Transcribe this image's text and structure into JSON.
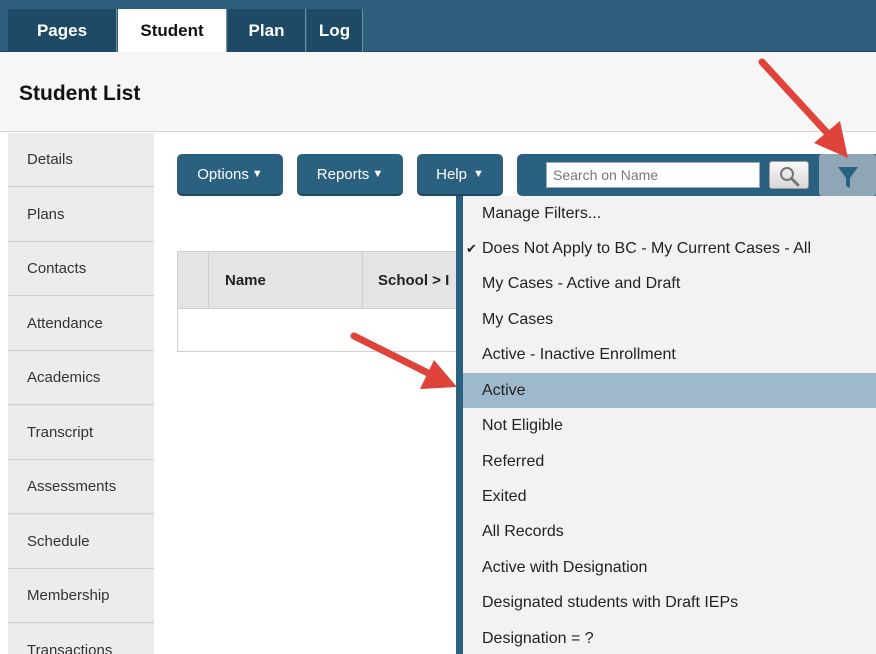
{
  "tabs": [
    {
      "label": "Pages",
      "active": false
    },
    {
      "label": "Student",
      "active": true
    },
    {
      "label": "Plan",
      "active": false
    },
    {
      "label": "Log",
      "active": false
    }
  ],
  "page_title": "Student List",
  "sidebar": {
    "items": [
      {
        "label": "Details"
      },
      {
        "label": "Plans"
      },
      {
        "label": "Contacts"
      },
      {
        "label": "Attendance"
      },
      {
        "label": "Academics"
      },
      {
        "label": "Transcript"
      },
      {
        "label": "Assessments"
      },
      {
        "label": "Schedule"
      },
      {
        "label": "Membership"
      },
      {
        "label": "Transactions"
      }
    ]
  },
  "toolbar": {
    "options_label": "Options",
    "reports_label": "Reports",
    "help_label": "Help",
    "caret": "▼"
  },
  "search": {
    "placeholder": "Search on Name",
    "search_icon": "magnifier-icon",
    "filter_icon": "funnel-icon"
  },
  "table": {
    "columns": [
      "Name",
      "School > I"
    ]
  },
  "filter_menu": {
    "items": [
      {
        "label": "Manage Filters...",
        "checked": false,
        "selected": false
      },
      {
        "label": "Does Not Apply to BC - My Current Cases - All",
        "checked": true,
        "selected": false
      },
      {
        "label": "My Cases - Active and Draft",
        "checked": false,
        "selected": false
      },
      {
        "label": "My Cases",
        "checked": false,
        "selected": false
      },
      {
        "label": "Active - Inactive Enrollment",
        "checked": false,
        "selected": false
      },
      {
        "label": "Active",
        "checked": false,
        "selected": true
      },
      {
        "label": "Not Eligible",
        "checked": false,
        "selected": false
      },
      {
        "label": "Referred",
        "checked": false,
        "selected": false
      },
      {
        "label": "Exited",
        "checked": false,
        "selected": false
      },
      {
        "label": "All Records",
        "checked": false,
        "selected": false
      },
      {
        "label": "Active with Designation",
        "checked": false,
        "selected": false
      },
      {
        "label": "Designated students with Draft IEPs",
        "checked": false,
        "selected": false
      },
      {
        "label": "Designation = ?",
        "checked": false,
        "selected": false
      }
    ],
    "check_glyph": "✔"
  },
  "colors": {
    "nav_bg": "#2d5f7c",
    "button_bg": "#2b6180",
    "selected_row": "#9eb9cc",
    "annotation_arrow": "#e0433a"
  }
}
